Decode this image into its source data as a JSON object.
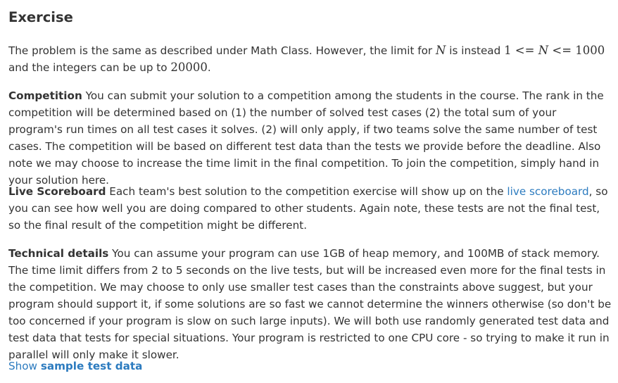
{
  "heading": "Exercise",
  "intro": {
    "text_1": "The problem is the same as described under Math Class. However, the limit for ",
    "math_n": "N",
    "text_2": " is instead ",
    "math_range_low": "1 <= ",
    "math_range_var": "N",
    "math_range_high": " <= 1000",
    "text_3": " and the integers can be up to ",
    "math_max": "20000",
    "text_4": "."
  },
  "competition": {
    "label": "Competition",
    "text": " You can submit your solution to a competition among the students in the course. The rank in the competition will be determined based on (1) the number of solved test cases (2) the total sum of your program's run times on all test cases it solves. (2) will only apply, if two teams solve the same number of test cases. The competition will be based on different test data than the tests we provide before the deadline. Also note we may choose to increase the time limit in the final competition. To join the competition, simply hand in your solution here."
  },
  "scoreboard": {
    "label": "Live Scoreboard",
    "text_1": " Each team's best solution to the competition exercise will show up on the ",
    "link": "live scoreboard",
    "text_2": ", so you can see how well you are doing compared to other students. Again note, these tests are not the final test, so the final result of the competition might be different."
  },
  "technical": {
    "label": "Technical details",
    "text": " You can assume your program can use 1GB of heap memory, and 100MB of stack memory. The time limit differs from 2 to 5 seconds on the live tests, but will be increased even more for the final tests in the competition. We may choose to only use smaller test cases than the constraints above suggest, but your program should support it, if some solutions are so fast we cannot determine the winners otherwise (so don't be too concerned if your program is slow on such large inputs). We will both use randomly generated test data and test data that tests for special situations. Your program is restricted to one CPU core - so trying to make it run in parallel will only make it slower."
  },
  "sample": {
    "prefix": "Show ",
    "label": "sample test data"
  },
  "colors": {
    "text": "#333333",
    "link": "#2c7bbf"
  }
}
